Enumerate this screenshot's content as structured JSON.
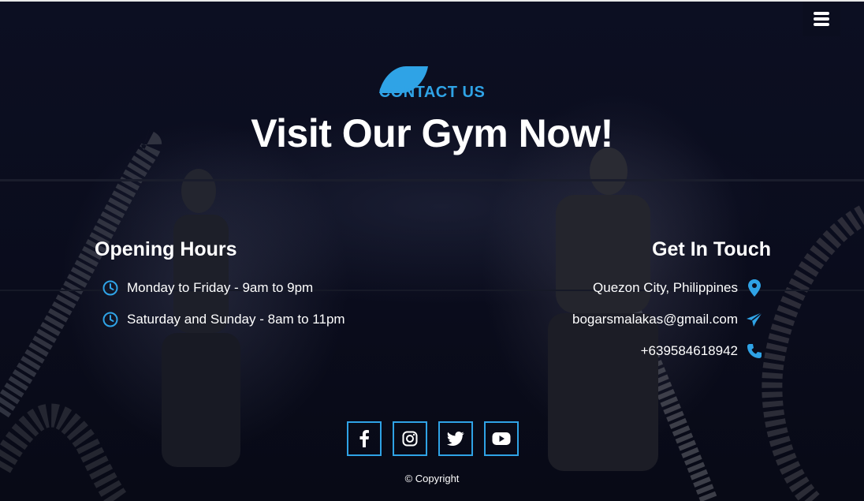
{
  "colors": {
    "accent": "#2fa3e6",
    "background": "#0b0e1f",
    "text": "#ffffff"
  },
  "menu": {
    "icon": "hamburger-menu-icon"
  },
  "contact": {
    "tag": "CONTACT US",
    "title": "Visit Our Gym Now!"
  },
  "hours": {
    "heading": "Opening Hours",
    "items": [
      {
        "icon": "clock-icon",
        "text": "Monday to Friday - 9am to 9pm"
      },
      {
        "icon": "clock-icon",
        "text": "Saturday and Sunday - 8am to 11pm"
      }
    ]
  },
  "touch": {
    "heading": "Get In Touch",
    "items": [
      {
        "icon": "location-pin-icon",
        "text": "Quezon City, Philippines"
      },
      {
        "icon": "paper-plane-icon",
        "text": "bogarsmalakas@gmail.com"
      },
      {
        "icon": "phone-icon",
        "text": "+639584618942"
      }
    ]
  },
  "socials": [
    {
      "icon": "facebook-icon"
    },
    {
      "icon": "instagram-icon"
    },
    {
      "icon": "twitter-icon"
    },
    {
      "icon": "youtube-icon"
    }
  ],
  "footer": {
    "copyright": "Copyright"
  }
}
